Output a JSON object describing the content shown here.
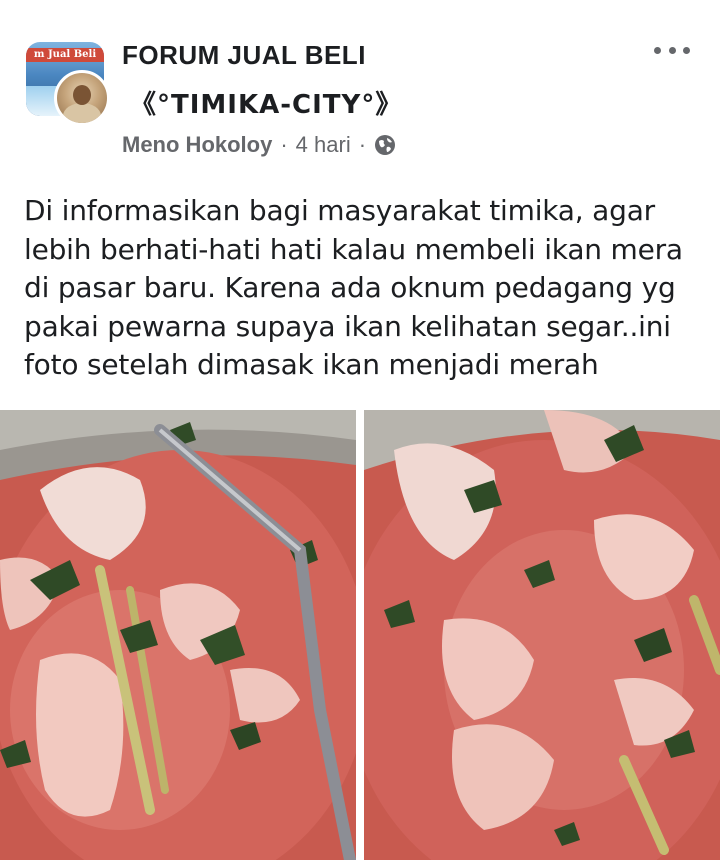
{
  "post": {
    "group_name_line1": "FORUM JUAL BELI",
    "group_name_line2": "《°TIMIKA-CITY°》",
    "avatar_banner_text": "m Jual Beli",
    "author": "Meno Hokoloy",
    "time": "4 hari",
    "separator": "·",
    "privacy_icon": "globe-icon",
    "more_icon": "more-horizontal-icon",
    "text_lines": [
      "Di informasikan bagi masyarakat timika, agar",
      "lebih berhati-hati hati kalau membeli ikan mera",
      "di pasar baru. Karena ada oknum pedagang yg",
      "pakai pewarna supaya ikan kelihatan segar..ini",
      "foto setelah dimasak ikan menjadi merah"
    ],
    "photos": [
      {
        "description": "pot-of-red-fish-soup-with-ladle"
      },
      {
        "description": "pot-of-red-fish-soup-closeup"
      }
    ]
  },
  "colors": {
    "text_primary": "#1c1e21",
    "text_secondary": "#65676b",
    "soup_red": "#c9584f"
  }
}
